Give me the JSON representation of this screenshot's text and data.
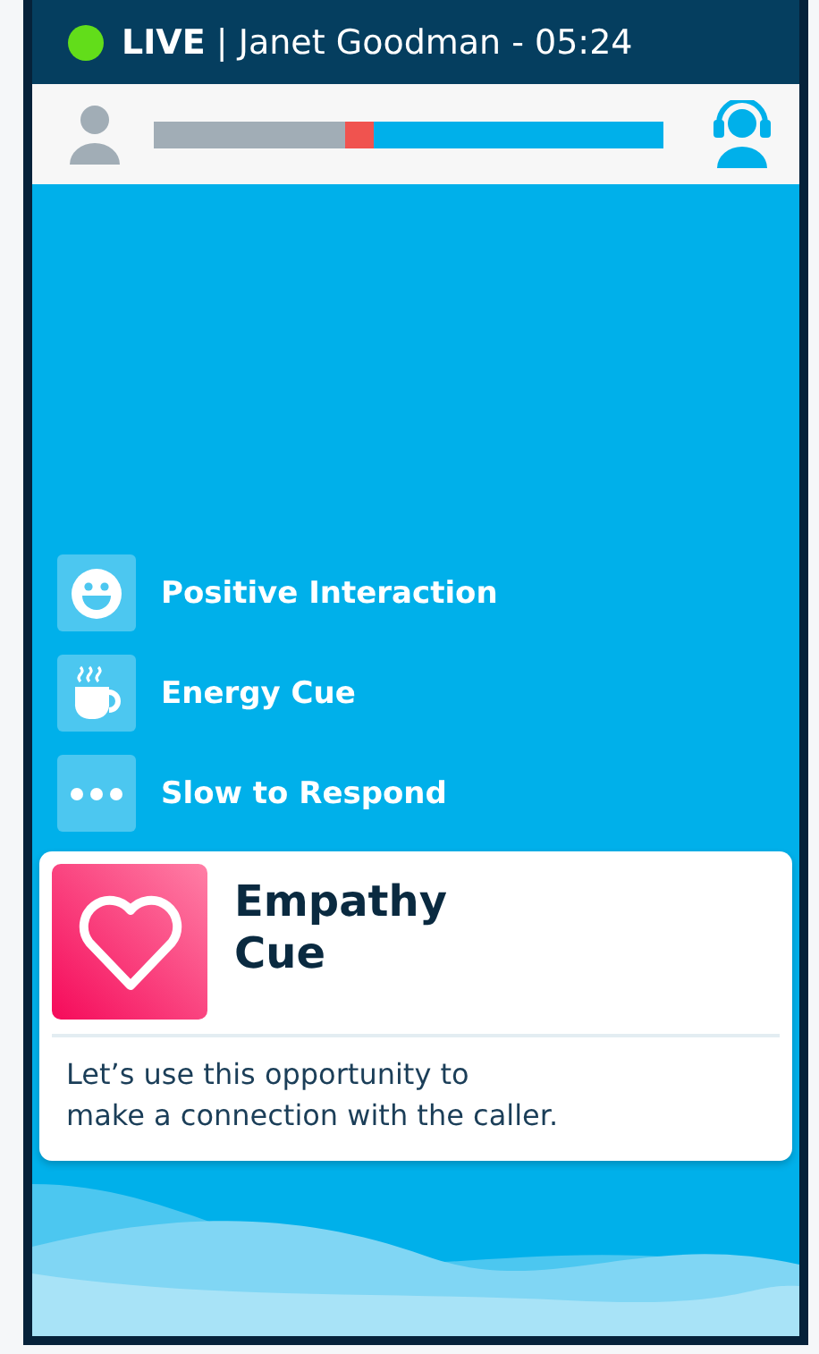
{
  "header": {
    "live": true,
    "status": "LIVE",
    "separator": "|",
    "caller": "Janet Goodman - 05:24"
  },
  "talk_bar": {
    "caller": {
      "level": 0.375
    },
    "overlap": {
      "level": 0.43
    }
  },
  "cues": [
    {
      "kind": "smile",
      "label": "Positive Interaction"
    },
    {
      "kind": "coffee",
      "label": "Energy Cue"
    },
    {
      "kind": "dots",
      "label": "Slow to Respond"
    }
  ],
  "active_cue": {
    "kind": "heart",
    "title": "Empathy\nCue",
    "message": "Let’s use this opportunity to\nmake a connection with the caller."
  }
}
